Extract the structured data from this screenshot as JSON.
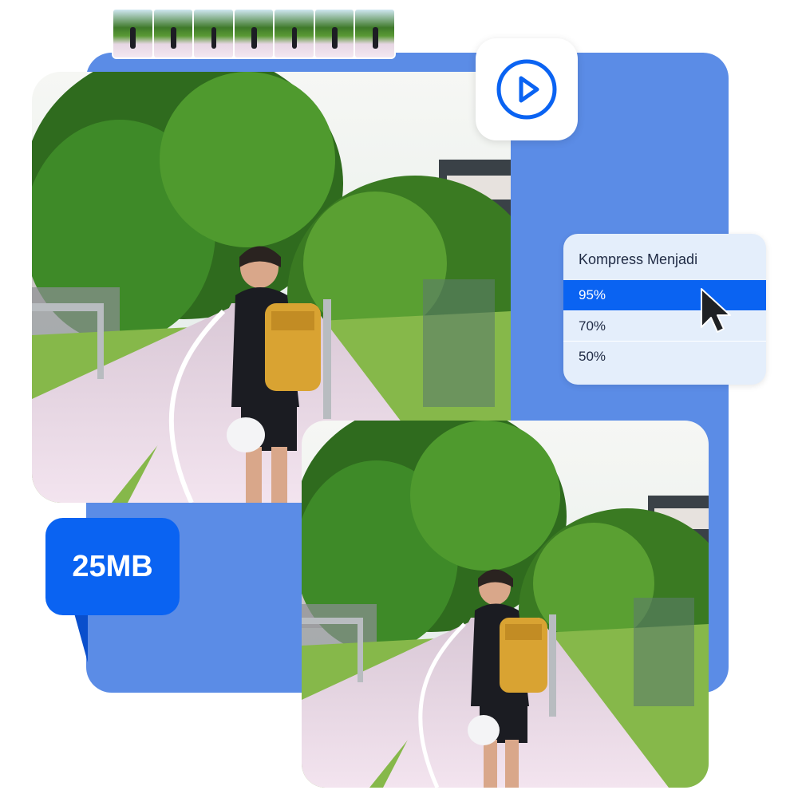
{
  "compress_menu": {
    "title": "Kompress Menjadi",
    "options": [
      {
        "label": "95%",
        "selected": true
      },
      {
        "label": "70%",
        "selected": false
      },
      {
        "label": "50%",
        "selected": false
      }
    ]
  },
  "file_size": {
    "label": "25MB"
  },
  "icons": {
    "play": "play-circle-icon",
    "cursor": "mouse-pointer-icon"
  },
  "colors": {
    "panel_blue": "#5b8ce6",
    "accent_blue": "#0a63f2",
    "menu_bg": "#e4eefb"
  }
}
